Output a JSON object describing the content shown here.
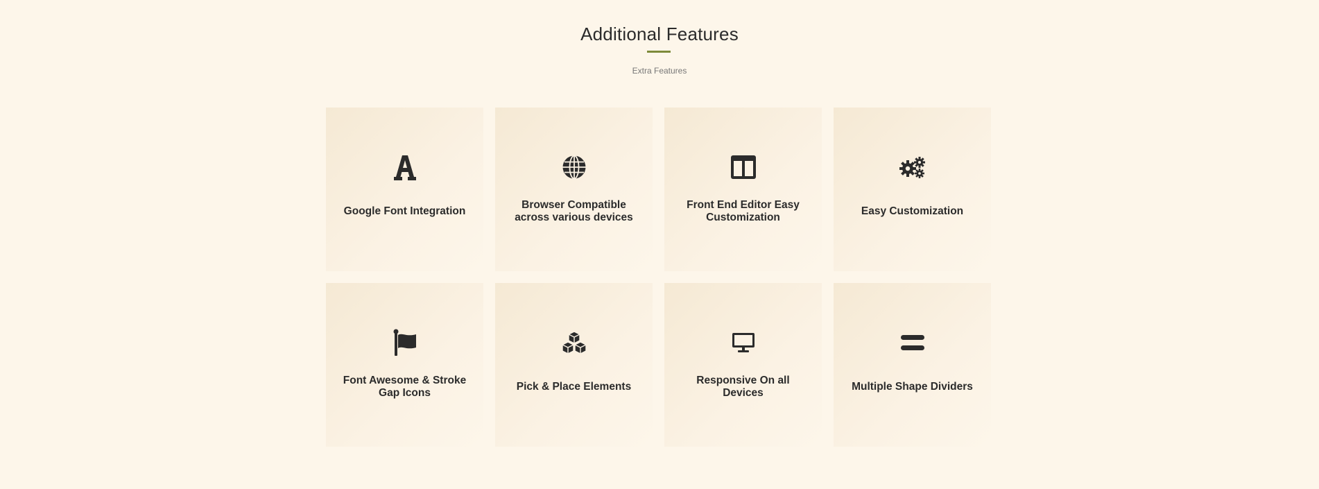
{
  "header": {
    "title": "Additional Features",
    "subtitle": "Extra Features",
    "accent_color": "#7d8a3a"
  },
  "features": [
    {
      "label": "Google Font Integration",
      "icon": "font-icon"
    },
    {
      "label": "Browser Compatible across various devices",
      "icon": "globe-icon"
    },
    {
      "label": "Front End Editor Easy Customization",
      "icon": "columns-icon"
    },
    {
      "label": "Easy Customization",
      "icon": "gears-icon"
    },
    {
      "label": "Font Awesome & Stroke Gap Icons",
      "icon": "flag-icon"
    },
    {
      "label": "Pick & Place Elements",
      "icon": "cubes-icon"
    },
    {
      "label": "Responsive On all Devices",
      "icon": "desktop-icon"
    },
    {
      "label": "Multiple Shape Dividers",
      "icon": "equals-icon"
    }
  ]
}
